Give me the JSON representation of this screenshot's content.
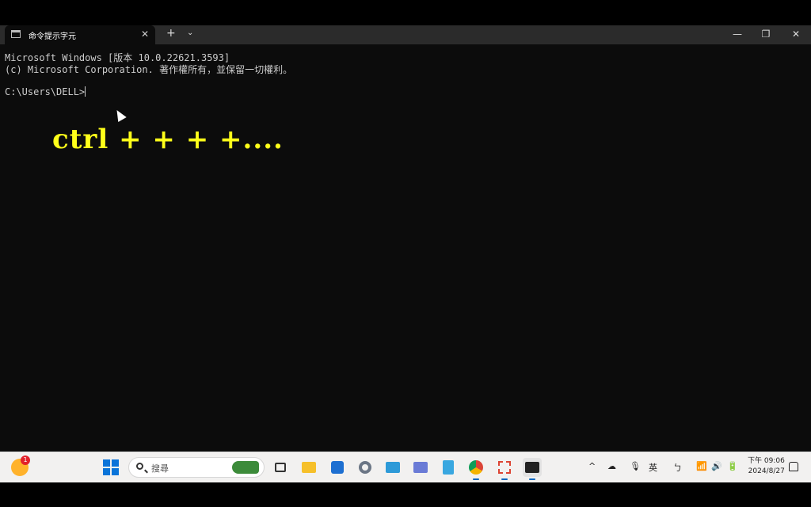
{
  "window": {
    "tab_title": "命令提示字元",
    "tab_close": "✕",
    "new_tab": "+",
    "tab_dropdown": "⌄",
    "minimize": "—",
    "maximize": "❐",
    "close": "✕"
  },
  "console": {
    "line1": "Microsoft Windows [版本 10.0.22621.3593]",
    "line2": "(c) Microsoft Corporation. 著作權所有，並保留一切權利。",
    "prompt": "C:\\Users\\DELL>"
  },
  "overlay_text": "ctrl + + + +....",
  "taskbar": {
    "widget_badge": "1",
    "search_placeholder": "搜尋",
    "apps": [
      "task-view-icon",
      "file-explorer-icon",
      "store-icon",
      "settings-icon",
      "photos-icon",
      "snipping-tool-icon",
      "notepad-icon",
      "chrome-icon",
      "paint-icon",
      "terminal-icon"
    ],
    "tray": {
      "chevron": "^",
      "ime_lang": "英",
      "ime_mode": "ㄅ"
    },
    "time": "下午 09:06",
    "date": "2024/8/27"
  },
  "colors": {
    "console_bg": "#0c0c0c",
    "console_text": "#cccccc",
    "overlay": "#ffff1a",
    "accent": "#0067c0"
  }
}
